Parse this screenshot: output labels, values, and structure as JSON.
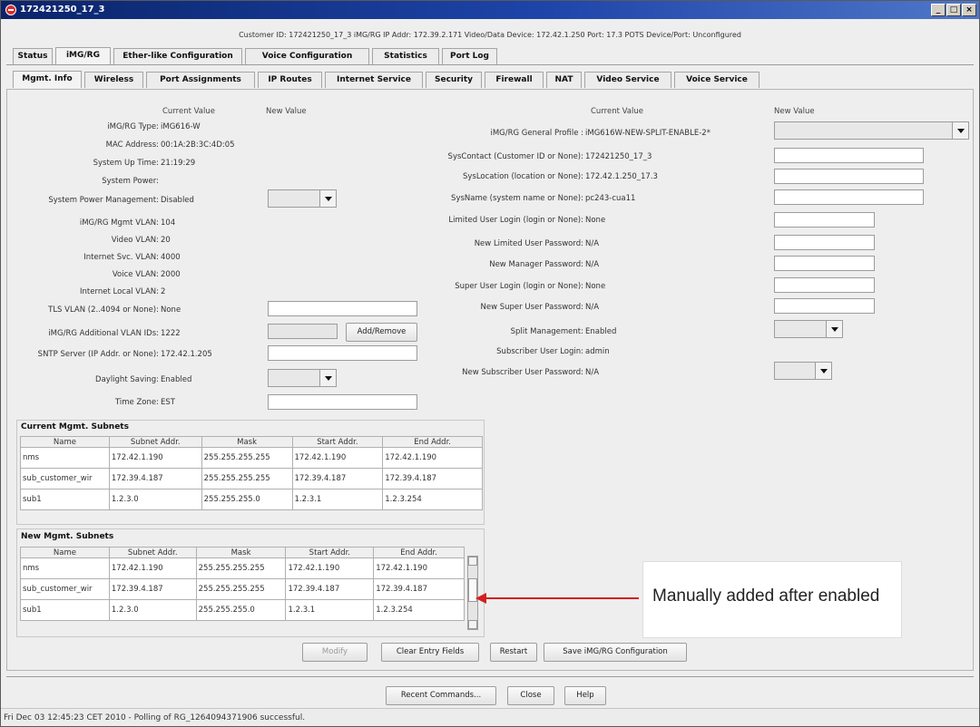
{
  "window": {
    "title": "172421250_17_3",
    "controls": [
      "_",
      "□",
      "×"
    ]
  },
  "info_bar": "Customer ID: 172421250_17_3    iMG/RG IP Addr: 172.39.2.171    Video/Data Device: 172.42.1.250    Port: 17.3   POTS Device/Port: Unconfigured",
  "main_tabs": [
    "Status",
    "iMG/RG",
    "Ether-like Configuration",
    "Voice Configuration",
    "Statistics",
    "Port Log"
  ],
  "sub_tabs": [
    "Mgmt. Info",
    "Wireless",
    "Port Assignments",
    "IP Routes",
    "Internet Service",
    "Security",
    "Firewall",
    "NAT",
    "Video Service",
    "Voice Service"
  ],
  "left": {
    "current_value_header": "Current Value",
    "new_value_header": "New Value",
    "rows": [
      {
        "label": "iMG/RG Type:",
        "value": "iMG616-W"
      },
      {
        "label": "MAC Address:",
        "value": "00:1A:2B:3C:4D:05"
      },
      {
        "label": "System Up Time:",
        "value": "21:19:29"
      },
      {
        "label": "System Power:",
        "value": ""
      },
      {
        "label": "System Power Management:",
        "value": "Disabled"
      },
      {
        "label": "iMG/RG Mgmt VLAN:",
        "value": "104"
      },
      {
        "label": "Video VLAN:",
        "value": "20"
      },
      {
        "label": "Internet Svc. VLAN:",
        "value": "4000"
      },
      {
        "label": "Voice VLAN:",
        "value": "2000"
      },
      {
        "label": "Internet Local VLAN:",
        "value": "2"
      },
      {
        "label": "TLS VLAN (2..4094 or None):",
        "value": "None"
      },
      {
        "label": "iMG/RG Additional VLAN IDs:",
        "value": "1222"
      },
      {
        "label": "SNTP Server (IP Addr. or None):",
        "value": "172.42.1.205"
      },
      {
        "label": "Daylight Saving:",
        "value": "Enabled"
      },
      {
        "label": "Time Zone:",
        "value": "EST"
      }
    ],
    "add_remove_button": "Add/Remove"
  },
  "right": {
    "current_value_header": "Current Value",
    "new_value_header": "New Value",
    "rows": [
      {
        "label": "iMG/RG General Profile :",
        "value": "iMG616W-NEW-SPLIT-ENABLE-2*"
      },
      {
        "label": "SysContact (Customer ID or None):",
        "value": "172421250_17_3"
      },
      {
        "label": "SysLocation (location or None):",
        "value": "172.42.1.250_17.3"
      },
      {
        "label": "SysName (system name or None):",
        "value": "pc243-cua11"
      },
      {
        "label": "Limited User Login (login or None):",
        "value": "None"
      },
      {
        "label": "New Limited User Password:",
        "value": "N/A"
      },
      {
        "label": "New Manager Password:",
        "value": "N/A"
      },
      {
        "label": "Super User Login (login or None):",
        "value": "None"
      },
      {
        "label": "New Super User Password:",
        "value": "N/A"
      },
      {
        "label": "Split Management:",
        "value": "Enabled"
      },
      {
        "label": "Subscriber User Login:",
        "value": "admin"
      },
      {
        "label": "New Subscriber User Password:",
        "value": "N/A"
      }
    ]
  },
  "current_subnets": {
    "title": "Current Mgmt. Subnets",
    "columns": [
      "Name",
      "Subnet Addr.",
      "Mask",
      "Start Addr.",
      "End Addr."
    ],
    "rows": [
      [
        "nms",
        "172.42.1.190",
        "255.255.255.255",
        "172.42.1.190",
        "172.42.1.190"
      ],
      [
        "sub_customer_wir",
        "172.39.4.187",
        "255.255.255.255",
        "172.39.4.187",
        "172.39.4.187"
      ],
      [
        "sub1",
        "1.2.3.0",
        "255.255.255.0",
        "1.2.3.1",
        "1.2.3.254"
      ]
    ]
  },
  "new_subnets": {
    "title": "New Mgmt. Subnets",
    "columns": [
      "Name",
      "Subnet Addr.",
      "Mask",
      "Start Addr.",
      "End Addr."
    ],
    "rows": [
      [
        "nms",
        "172.42.1.190",
        "255.255.255.255",
        "172.42.1.190",
        "172.42.1.190"
      ],
      [
        "sub_customer_wir",
        "172.39.4.187",
        "255.255.255.255",
        "172.39.4.187",
        "172.39.4.187"
      ],
      [
        "sub1",
        "1.2.3.0",
        "255.255.255.0",
        "1.2.3.1",
        "1.2.3.254"
      ]
    ]
  },
  "annotation": "Manually added after enabled",
  "action_buttons": [
    "Modify",
    "Clear Entry Fields",
    "Restart",
    "Save iMG/RG Configuration"
  ],
  "bottom_buttons": [
    "Recent Commands...",
    "Close",
    "Help"
  ],
  "status": "Fri Dec 03 12:45:23 CET 2010 - Polling of RG_1264094371906 successful.",
  "colors": {
    "titlebar": "#0a246a",
    "arrow": "#d51f1f"
  }
}
